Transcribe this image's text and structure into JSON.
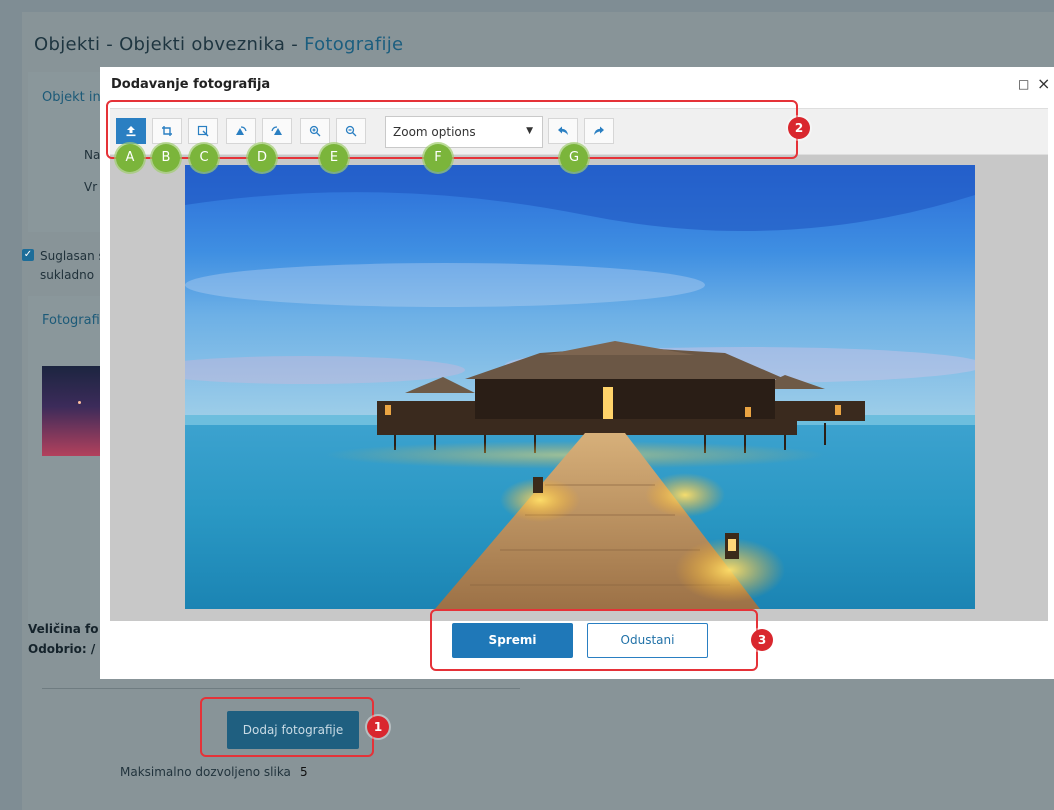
{
  "background": {
    "breadcrumb_prefix": "Objekti - Objekti obveznika - ",
    "breadcrumb_current": "Fotografije",
    "section_object": "Objekt in",
    "field_na": "Na",
    "field_vr": "Vr",
    "consent_line1": "Suglasan s",
    "consent_line2": "sukladno",
    "section_photos": "Fotografi",
    "size_label": "Veličina fo",
    "approved_label": "Odobrio: /",
    "add_photo_button": "Dodaj fotografije",
    "max_images_label": "Maksimalno dozvoljeno slika",
    "max_images_value": "5"
  },
  "modal": {
    "title": "Dodavanje fotografija",
    "maximize_glyph": "□",
    "close_glyph": "×",
    "toolbar": {
      "buttons": [
        {
          "name": "upload",
          "icon": "upload-icon"
        },
        {
          "name": "crop",
          "icon": "crop-icon"
        },
        {
          "name": "fit",
          "icon": "fit-icon"
        },
        {
          "name": "rotate-left",
          "icon": "rotate-left-icon"
        },
        {
          "name": "rotate-right",
          "icon": "rotate-right-icon"
        },
        {
          "name": "zoom-in",
          "icon": "zoom-in-icon"
        },
        {
          "name": "zoom-out",
          "icon": "zoom-out-icon"
        },
        {
          "name": "undo",
          "icon": "undo-icon"
        },
        {
          "name": "redo",
          "icon": "redo-icon"
        }
      ],
      "zoom_select_value": "Zoom options",
      "zoom_caret": "▼"
    },
    "save_button": "Spremi",
    "cancel_button": "Odustani"
  },
  "annotations": {
    "red_numbers": [
      "1",
      "2",
      "3"
    ],
    "green_letters": [
      "A",
      "B",
      "C",
      "D",
      "E",
      "F",
      "G"
    ]
  },
  "colors": {
    "accent": "#1f78b8",
    "annotation_red": "#e53238",
    "annotation_green": "#7bb53b",
    "overlay": "#7f8d94"
  }
}
